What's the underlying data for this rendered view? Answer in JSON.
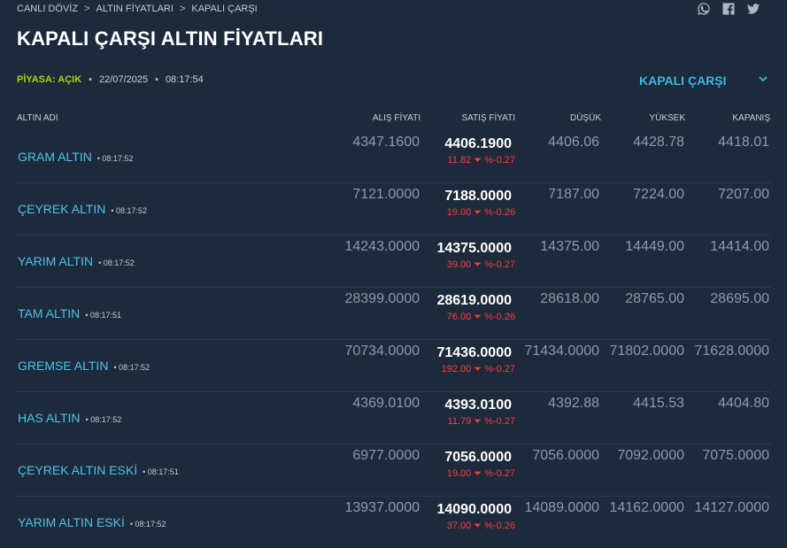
{
  "breadcrumb": [
    "CANLI DÖVİZ",
    "ALTIN FİYATLARI",
    "KAPALI ÇARŞI"
  ],
  "breadcrumb_sep": ">",
  "title": "KAPALI ÇARŞI ALTIN FİYATLARI",
  "status": {
    "market_label": "PİYASA: AÇIK",
    "date": "22/07/2025",
    "time": "08:17:54",
    "dot": "•"
  },
  "market_select": "KAPALI ÇARŞI",
  "columns": [
    "ALTIN ADI",
    "ALIŞ FİYATI",
    "SATIŞ FİYATI",
    "DÜŞÜK",
    "YÜKSEK",
    "KAPANIŞ"
  ],
  "rows": [
    {
      "name": "GRAM ALTIN",
      "time": "• 08:17:52",
      "buy": "4347.1600",
      "sell": "4406.1900",
      "change": "11.82 ⏷ %-0.27",
      "low": "4406.06",
      "high": "4428.78",
      "close": "4418.01"
    },
    {
      "name": "ÇEYREK ALTIN",
      "time": "• 08:17:52",
      "buy": "7121.0000",
      "sell": "7188.0000",
      "change": "19.00 ⏷ %-0.26",
      "low": "7187.00",
      "high": "7224.00",
      "close": "7207.00"
    },
    {
      "name": "YARIM ALTIN",
      "time": "• 08:17:52",
      "buy": "14243.0000",
      "sell": "14375.0000",
      "change": "39.00 ⏷ %-0.27",
      "low": "14375.00",
      "high": "14449.00",
      "close": "14414.00"
    },
    {
      "name": "TAM ALTIN",
      "time": "• 08:17:51",
      "buy": "28399.0000",
      "sell": "28619.0000",
      "change": "76.00 ⏷ %-0.26",
      "low": "28618.00",
      "high": "28765.00",
      "close": "28695.00"
    },
    {
      "name": "GREMSE ALTIN",
      "time": "• 08:17:52",
      "buy": "70734.0000",
      "sell": "71436.0000",
      "change": "192.00 ⏷ %-0.27",
      "low": "71434.0000",
      "high": "71802.0000",
      "close": "71628.0000"
    },
    {
      "name": "HAS ALTIN",
      "time": "• 08:17:52",
      "buy": "4369.0100",
      "sell": "4393.0100",
      "change": "11.79 ⏷ %-0.27",
      "low": "4392.88",
      "high": "4415.53",
      "close": "4404.80"
    },
    {
      "name": "ÇEYREK ALTIN ESKİ",
      "time": "• 08:17:51",
      "buy": "6977.0000",
      "sell": "7056.0000",
      "change": "19.00 ⏷ %-0.27",
      "low": "7056.0000",
      "high": "7092.0000",
      "close": "7075.0000"
    },
    {
      "name": "YARIM ALTIN ESKİ",
      "time": "• 08:17:52",
      "buy": "13937.0000",
      "sell": "14090.0000",
      "change": "37.00 ⏷ %-0.26",
      "low": "14089.0000",
      "high": "14162.0000",
      "close": "14127.0000"
    }
  ],
  "icons": [
    "whatsapp-icon",
    "facebook-icon",
    "twitter-icon",
    "chevron-down-icon",
    "caret-down-icon"
  ],
  "colors": {
    "background": "#1c2a3c",
    "accent": "#4ec3ea",
    "open": "#a6d31b",
    "down": "#ff3a3a"
  }
}
